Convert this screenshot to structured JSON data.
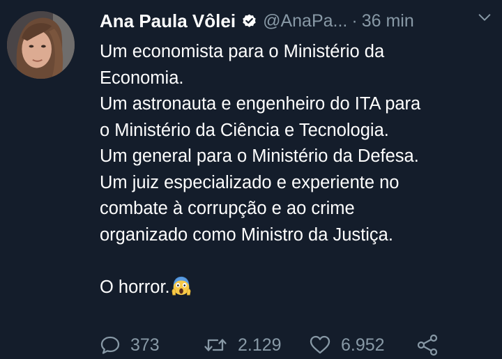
{
  "tweet": {
    "display_name": "Ana Paula Vôlei",
    "handle": "@AnaPa...",
    "separator": "·",
    "time": "36 min",
    "lines": [
      "Um economista para o Ministério da",
      "Economia.",
      "Um astronauta e engenheiro do ITA para",
      "o Ministério da Ciência e Tecnologia.",
      "Um general para o Ministério da Defesa.",
      "Um juiz especializado e experiente no",
      "combate à corrupção e ao crime",
      "organizado como Ministro da Justiça."
    ],
    "closing": "O horror.",
    "closing_emoji": "face-screaming-in-fear-emoji"
  },
  "actions": {
    "replies": "373",
    "retweets": "2.129",
    "likes": "6.952"
  },
  "icons": {
    "verified": "verified-badge-icon",
    "menu": "chevron-down-icon",
    "reply": "reply-icon",
    "retweet": "retweet-icon",
    "like": "heart-icon",
    "share": "share-icon"
  },
  "colors": {
    "background": "#141d2b",
    "text": "#ffffff",
    "muted": "#8899a6"
  }
}
